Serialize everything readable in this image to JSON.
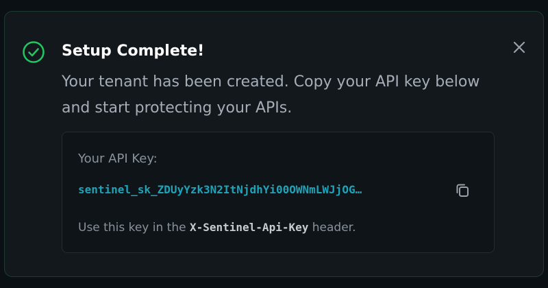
{
  "dialog": {
    "title": "Setup Complete!",
    "description": "Your tenant has been created. Copy your API key below and start protecting your APIs.",
    "status_icon": "check-circle-icon",
    "close_icon": "close-icon",
    "api_key": {
      "label": "Your API Key:",
      "value": "sentinel_sk_ZDUyYzk3N2ItNjdhYi00OWNmLWJjOG…",
      "copy_icon": "copy-icon",
      "hint_prefix": "Use this key in the",
      "hint_header": "X-Sentinel-Api-Key",
      "hint_suffix": "header."
    }
  },
  "colors": {
    "success": "#22c55e",
    "key_text": "#1fa3b8",
    "panel_bg": "#12181c",
    "box_bg": "#0f1418"
  }
}
